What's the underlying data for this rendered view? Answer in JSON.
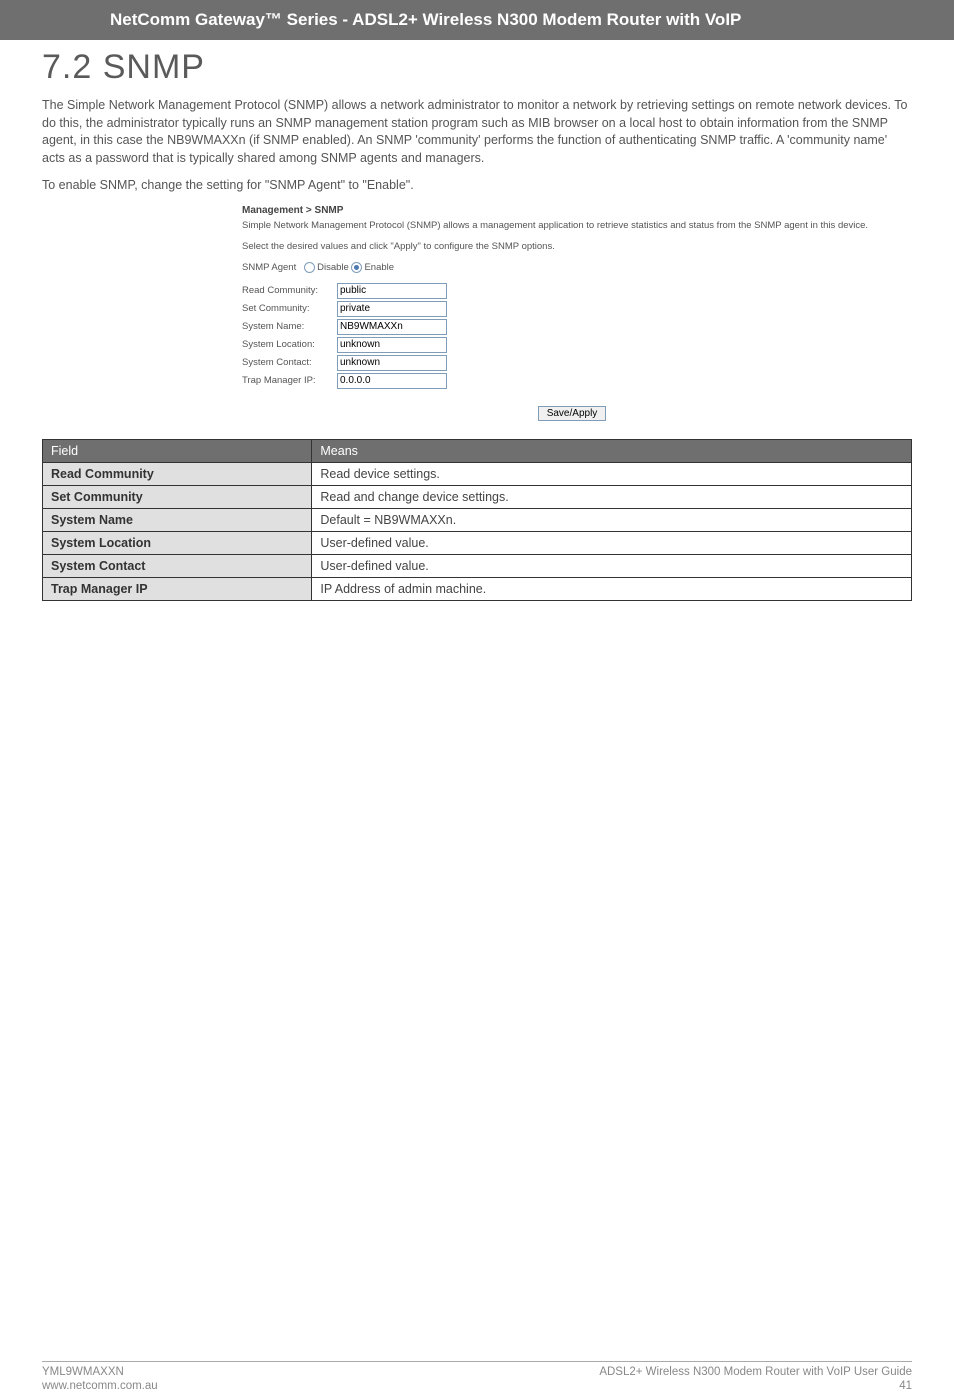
{
  "banner": "NetComm Gateway™ Series - ADSL2+ Wireless N300 Modem Router with VoIP",
  "heading": "7.2 SNMP",
  "para1": "The Simple Network Management Protocol (SNMP) allows a network administrator to monitor a network by retrieving settings on remote network devices.  To do this, the administrator typically runs an SNMP management station program such as MIB browser on a local host to obtain information from the SNMP agent, in this case the NB9WMAXXn (if SNMP enabled). An SNMP 'community' performs the function of authenticating SNMP traffic. A 'community name' acts as a password that is typically shared among  SNMP agents and managers.",
  "para2": "To enable SNMP, change the setting for \"SNMP Agent\" to \"Enable\".",
  "shot": {
    "title": "Management > SNMP",
    "line1": "Simple Network Management Protocol (SNMP) allows a management application to retrieve statistics and status from the SNMP agent in this device.",
    "line2": "Select the desired values and click \"Apply\" to configure the SNMP options.",
    "agent_label": "SNMP Agent",
    "disable": "Disable",
    "enable": "Enable",
    "fields": {
      "read_label": "Read Community:",
      "read_val": "public",
      "set_label": "Set Community:",
      "set_val": "private",
      "name_label": "System Name:",
      "name_val": "NB9WMAXXn",
      "loc_label": "System Location:",
      "loc_val": "unknown",
      "contact_label": "System Contact:",
      "contact_val": "unknown",
      "trap_label": "Trap Manager IP:",
      "trap_val": "0.0.0.0"
    },
    "button": "Save/Apply"
  },
  "table": {
    "h1": "Field",
    "h2": "Means",
    "rows": [
      {
        "f": "Read Community",
        "m": "Read device settings."
      },
      {
        "f": "Set Community",
        "m": "Read and change device settings."
      },
      {
        "f": "System Name",
        "m": "Default = NB9WMAXXn."
      },
      {
        "f": "System Location",
        "m": "User-defined value."
      },
      {
        "f": "System Contact",
        "m": "User-defined value."
      },
      {
        "f": "Trap Manager IP",
        "m": "IP Address of admin machine."
      }
    ]
  },
  "footer": {
    "left1": "YML9WMAXXN",
    "left2": "www.netcomm.com.au",
    "right1": "ADSL2+ Wireless N300 Modem Router with VoIP User Guide",
    "right2": "41"
  }
}
